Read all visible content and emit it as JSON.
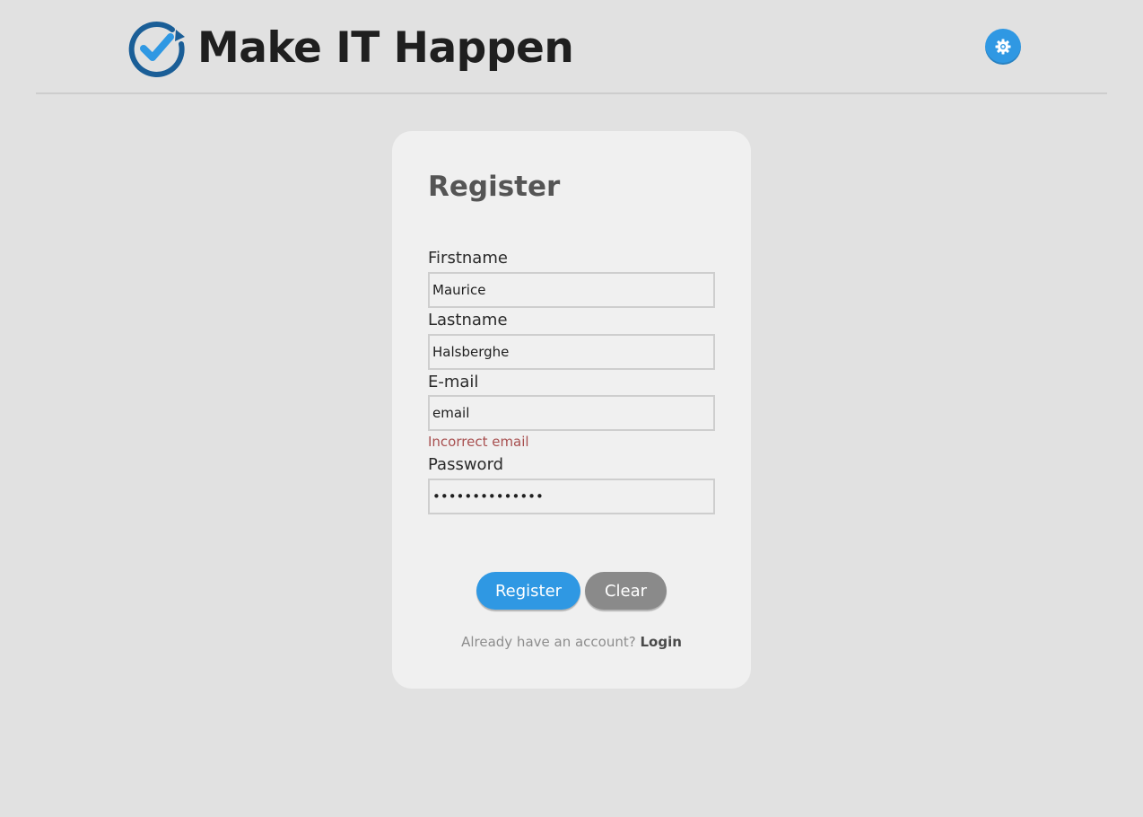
{
  "header": {
    "app_title": "Make IT Happen",
    "logo_icon": "check-circle-arrow-icon",
    "settings_icon": "gear-icon",
    "accent_color": "#2f98e3"
  },
  "form": {
    "title": "Register",
    "fields": {
      "firstname": {
        "label": "Firstname",
        "value": "Maurice"
      },
      "lastname": {
        "label": "Lastname",
        "value": "Halsberghe"
      },
      "email": {
        "label": "E-mail",
        "value": "email",
        "error": "Incorrect email"
      },
      "password": {
        "label": "Password",
        "value": "••••••••••••••"
      }
    },
    "buttons": {
      "register_label": "Register",
      "clear_label": "Clear"
    },
    "login_prompt": "Already have an account?",
    "login_link": "Login"
  },
  "colors": {
    "background": "#e1e1e1",
    "card": "#f0f0f0",
    "primary_button": "#2f98e3",
    "secondary_button": "#8a8a8a",
    "error": "#a85050"
  }
}
